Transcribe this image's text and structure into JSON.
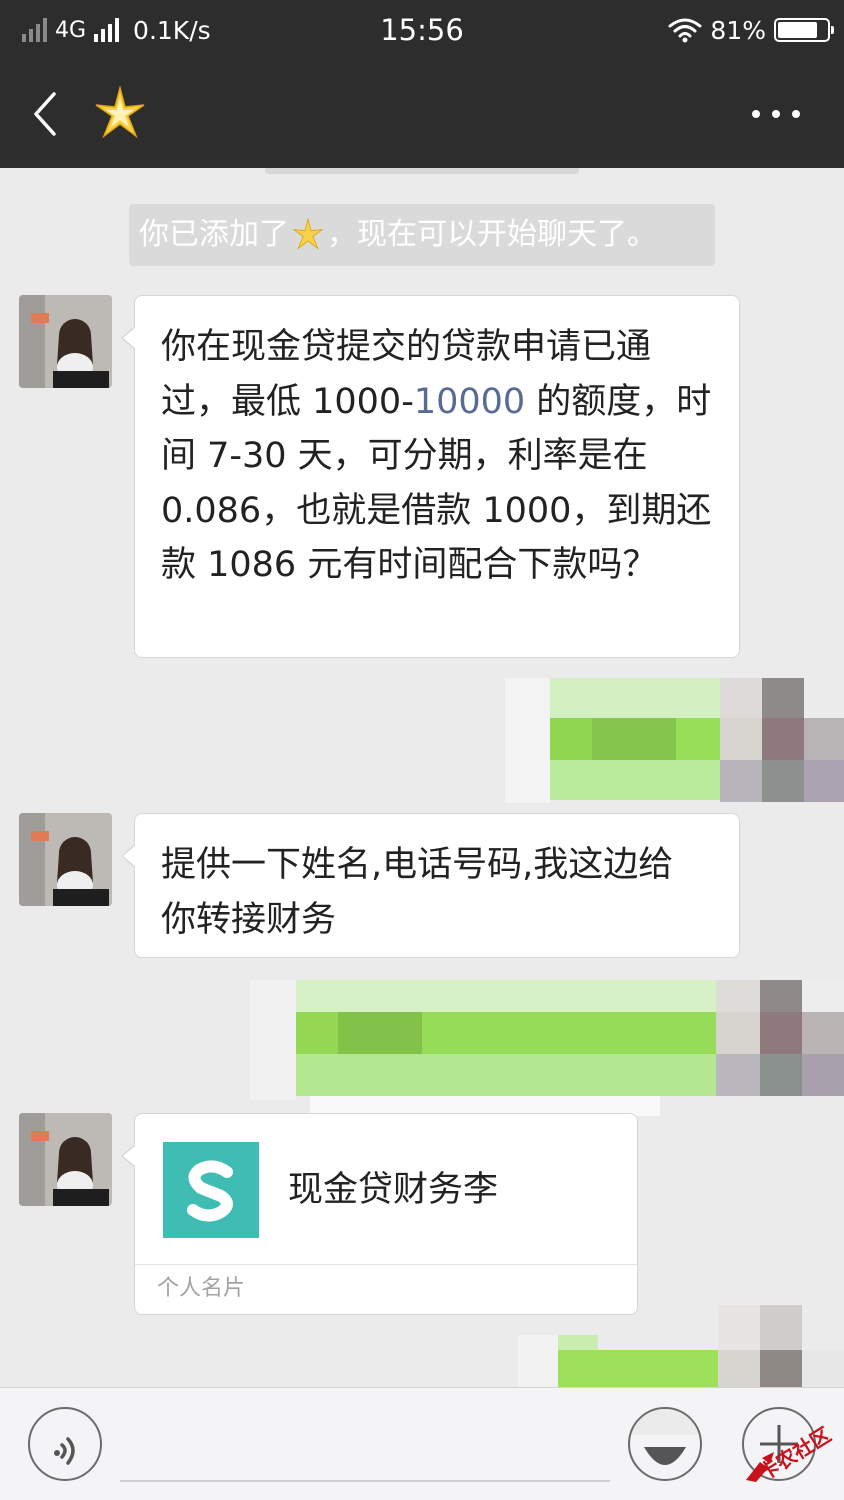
{
  "status_bar": {
    "network": "4G",
    "speed": "0.1K/s",
    "time": "15:56",
    "battery": "81%",
    "battery_level": 0.81
  },
  "header": {
    "contact_icon": "star-emoji-icon"
  },
  "chat": {
    "system_notice": {
      "before": "你已添加了",
      "after": "，现在可以开始聊天了。"
    },
    "messages": [
      {
        "type": "text",
        "lines": [
          "你在现金贷提交的贷款申请已通",
          "过，最低 1000-",
          "10000",
          " 的额度，时",
          "间 7-30 天，可分期，利率是在",
          "0.086，也就是借款 1000，到期还",
          "款 1086 元有时间配合下款吗？"
        ]
      },
      {
        "type": "text",
        "lines": [
          "提供一下姓名,电话号码,我这边给",
          "你转接财务"
        ]
      },
      {
        "type": "card",
        "name": "现金贷财务李",
        "footer": "个人名片"
      }
    ]
  },
  "input_bar": {
    "placeholder": ""
  },
  "watermark": {
    "text": "卡农社区"
  },
  "colors": {
    "header_bg": "#2d2d2d",
    "chat_bg": "#ebebeb",
    "link": "#576b95",
    "card_logo": "#3fbdb2",
    "sent_bubble": "#9fe658"
  }
}
